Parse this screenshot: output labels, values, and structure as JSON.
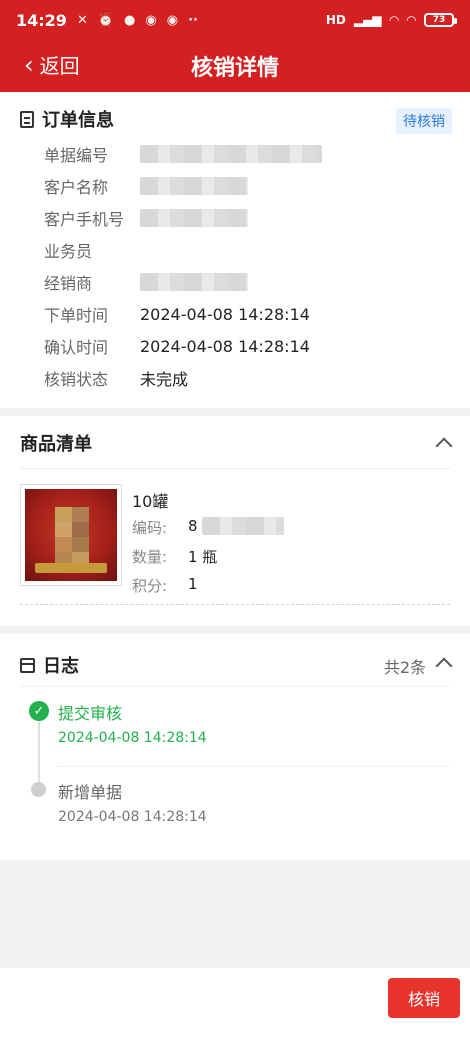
{
  "status_bar": {
    "time": "14:29",
    "icons": [
      "mute-icon",
      "alarm-icon",
      "app-icon",
      "app-icon",
      "app-icon",
      "more-icon"
    ],
    "network": "HD",
    "battery": "73"
  },
  "nav": {
    "back_label": "返回",
    "title": "核销详情"
  },
  "order": {
    "section_title": "订单信息",
    "status_badge": "待核销",
    "rows": [
      {
        "label": "单据编号",
        "value": ""
      },
      {
        "label": "客户名称",
        "value": ""
      },
      {
        "label": "客户手机号",
        "value": ""
      },
      {
        "label": "业务员",
        "value": ""
      },
      {
        "label": "经销商",
        "value": ""
      },
      {
        "label": "下单时间",
        "value": "2024-04-08 14:28:14"
      },
      {
        "label": "确认时间",
        "value": "2024-04-08 14:28:14"
      },
      {
        "label": "核销状态",
        "value": "未完成"
      }
    ]
  },
  "goods": {
    "section_title": "商品清单",
    "item": {
      "name": "10罐",
      "code_label": "编码:",
      "code_value": "8",
      "qty_label": "数量:",
      "qty_value": "1 瓶",
      "points_label": "积分:",
      "points_value": "1"
    }
  },
  "log": {
    "section_title": "日志",
    "count": "共2条",
    "entries": [
      {
        "title": "提交审核",
        "time": "2024-04-08 14:28:14",
        "state": "done"
      },
      {
        "title": "新增单据",
        "time": "2024-04-08 14:28:14",
        "state": "pending"
      }
    ]
  },
  "footer": {
    "action_label": "核销"
  },
  "colors": {
    "brand_red": "#d42020",
    "button_red": "#e8342c",
    "success_green": "#22b14c",
    "badge_blue": "#2b7be0"
  }
}
